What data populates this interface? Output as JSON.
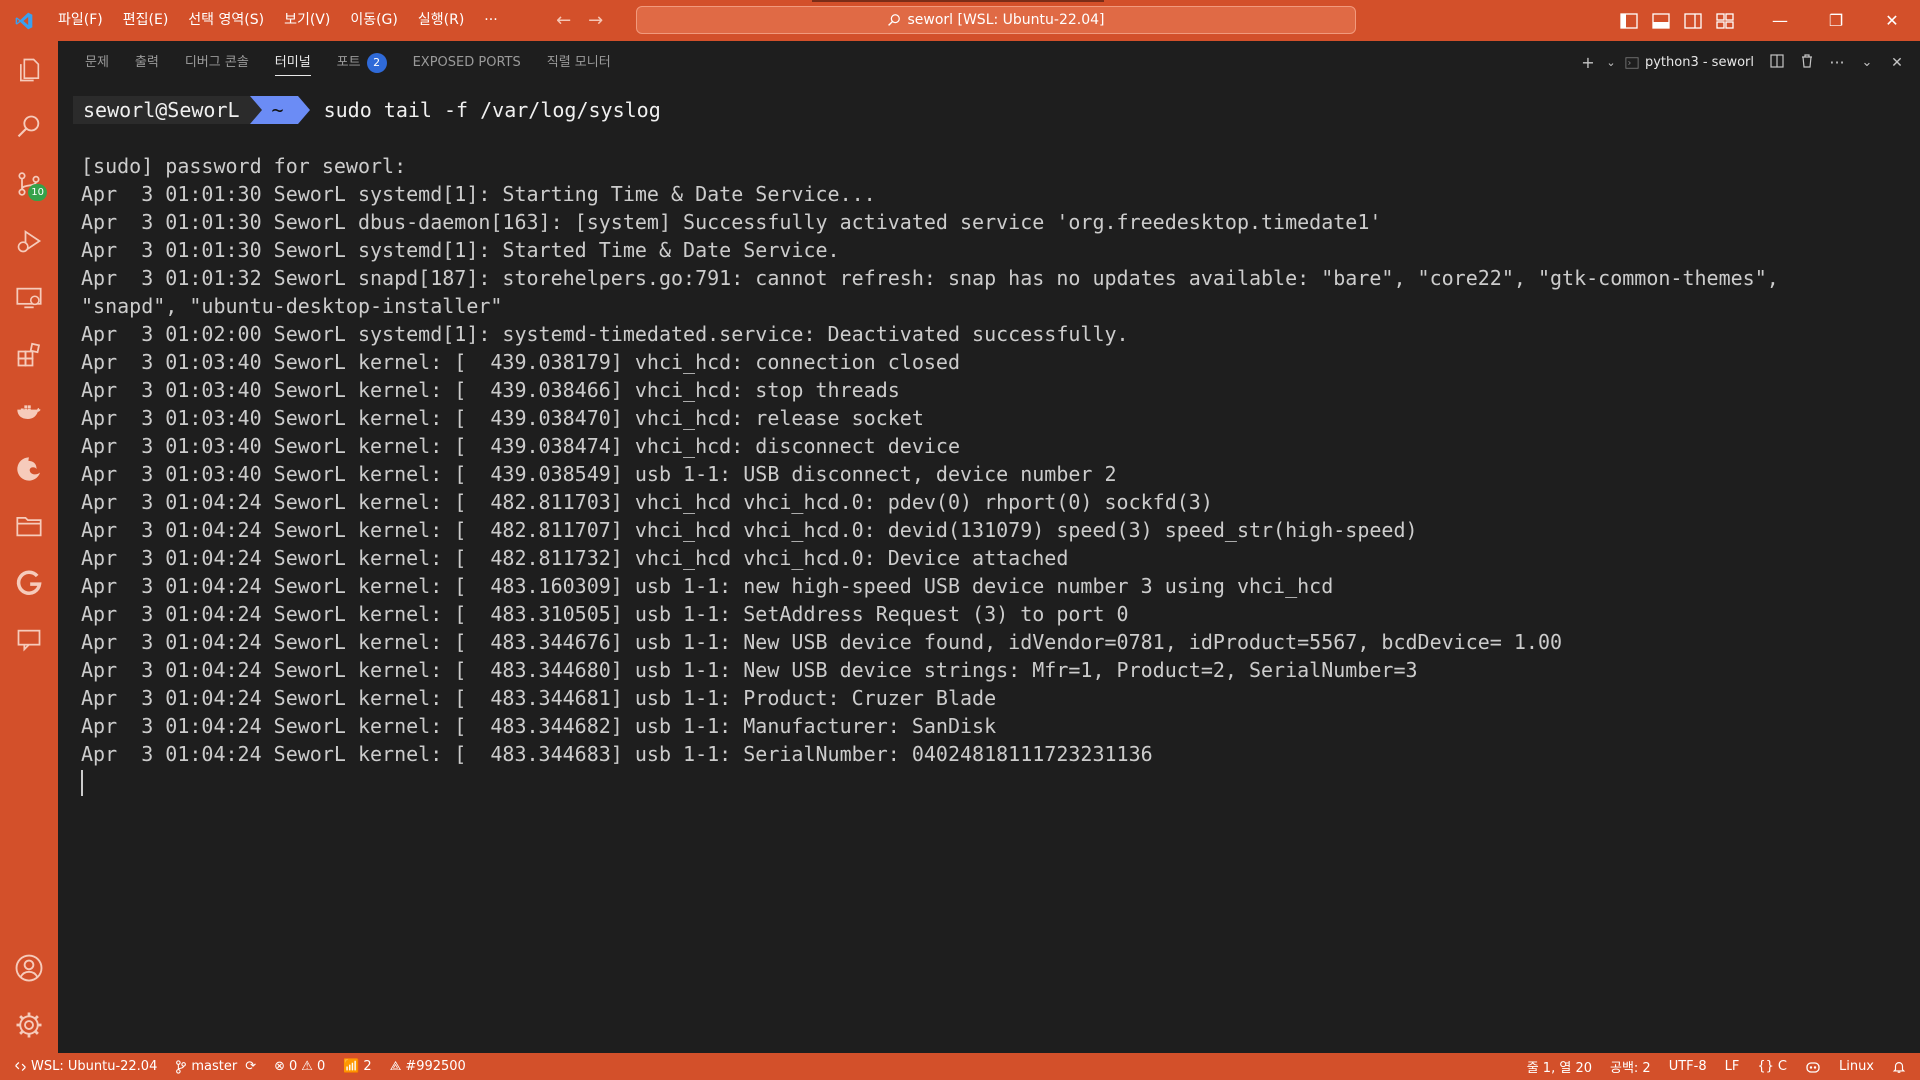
{
  "titlebar": {
    "menu": [
      "파일(F)",
      "편집(E)",
      "선택 영역(S)",
      "보기(V)",
      "이동(G)",
      "실행(R)",
      "···"
    ],
    "search_text": "seworl [WSL: Ubuntu-22.04]",
    "accent_color": "#d3502a"
  },
  "activitybar": {
    "icons": [
      "explorer-icon",
      "search-icon",
      "source-control-icon",
      "run-debug-icon",
      "remote-explorer-icon",
      "extensions-icon",
      "docker-icon",
      "edge-icon",
      "folder-icon",
      "gitlens-icon",
      "comments-icon"
    ],
    "source_control_badge": "10",
    "bottom_icons": [
      "account-icon",
      "settings-gear-icon"
    ]
  },
  "panel": {
    "tabs": [
      {
        "label": "문제",
        "active": false
      },
      {
        "label": "출력",
        "active": false
      },
      {
        "label": "디버그 콘솔",
        "active": false
      },
      {
        "label": "터미널",
        "active": true
      },
      {
        "label": "포트",
        "active": false,
        "badge": "2"
      },
      {
        "label": "EXPOSED PORTS",
        "active": false
      },
      {
        "label": "직렬 모니터",
        "active": false
      }
    ],
    "terminal_name": "python3 - seworl"
  },
  "terminal": {
    "prompt_user": "seworl@SeworL",
    "prompt_dir": "~",
    "command": "sudo tail -f /var/log/syslog",
    "lines": [
      "[sudo] password for seworl:",
      "Apr  3 01:01:30 SeworL systemd[1]: Starting Time & Date Service...",
      "Apr  3 01:01:30 SeworL dbus-daemon[163]: [system] Successfully activated service 'org.freedesktop.timedate1'",
      "Apr  3 01:01:30 SeworL systemd[1]: Started Time & Date Service.",
      "Apr  3 01:01:32 SeworL snapd[187]: storehelpers.go:791: cannot refresh: snap has no updates available: \"bare\", \"core22\", \"gtk-common-themes\", \"snapd\", \"ubuntu-desktop-installer\"",
      "Apr  3 01:02:00 SeworL systemd[1]: systemd-timedated.service: Deactivated successfully.",
      "Apr  3 01:03:40 SeworL kernel: [  439.038179] vhci_hcd: connection closed",
      "Apr  3 01:03:40 SeworL kernel: [  439.038466] vhci_hcd: stop threads",
      "Apr  3 01:03:40 SeworL kernel: [  439.038470] vhci_hcd: release socket",
      "Apr  3 01:03:40 SeworL kernel: [  439.038474] vhci_hcd: disconnect device",
      "Apr  3 01:03:40 SeworL kernel: [  439.038549] usb 1-1: USB disconnect, device number 2",
      "Apr  3 01:04:24 SeworL kernel: [  482.811703] vhci_hcd vhci_hcd.0: pdev(0) rhport(0) sockfd(3)",
      "Apr  3 01:04:24 SeworL kernel: [  482.811707] vhci_hcd vhci_hcd.0: devid(131079) speed(3) speed_str(high-speed)",
      "Apr  3 01:04:24 SeworL kernel: [  482.811732] vhci_hcd vhci_hcd.0: Device attached",
      "Apr  3 01:04:24 SeworL kernel: [  483.160309] usb 1-1: new high-speed USB device number 3 using vhci_hcd",
      "Apr  3 01:04:24 SeworL kernel: [  483.310505] usb 1-1: SetAddress Request (3) to port 0",
      "Apr  3 01:04:24 SeworL kernel: [  483.344676] usb 1-1: New USB device found, idVendor=0781, idProduct=5567, bcdDevice= 1.00",
      "Apr  3 01:04:24 SeworL kernel: [  483.344680] usb 1-1: New USB device strings: Mfr=1, Product=2, SerialNumber=3",
      "Apr  3 01:04:24 SeworL kernel: [  483.344681] usb 1-1: Product: Cruzer Blade",
      "Apr  3 01:04:24 SeworL kernel: [  483.344682] usb 1-1: Manufacturer: SanDisk",
      "Apr  3 01:04:24 SeworL kernel: [  483.344683] usb 1-1: SerialNumber: 04024818111723231136"
    ]
  },
  "statusbar": {
    "remote": "WSL: Ubuntu-22.04",
    "branch": "master",
    "errors": "0",
    "warnings": "0",
    "ports": "2",
    "color_tag": "#992500",
    "position": "줄 1, 열 20",
    "indent": "공백: 2",
    "encoding": "UTF-8",
    "eol": "LF",
    "language": "C",
    "os": "Linux"
  }
}
